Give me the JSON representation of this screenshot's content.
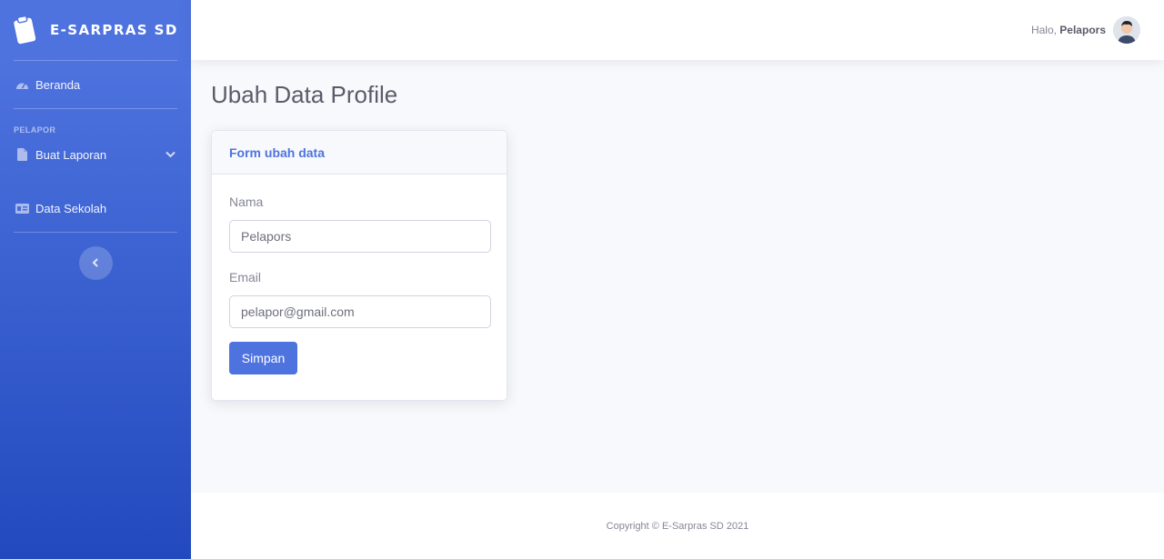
{
  "sidebar": {
    "brand": "E-SARPRAS SD",
    "items": [
      {
        "label": "Beranda",
        "icon": "dashboard-icon"
      },
      {
        "label": "Buat Laporan",
        "icon": "file-icon"
      },
      {
        "label": "Data Sekolah",
        "icon": "id-card-icon"
      }
    ],
    "heading": "PELAPOR",
    "accent": "#4e73df"
  },
  "topbar": {
    "greeting": "Halo,",
    "user_name": "Pelapors"
  },
  "main": {
    "title": "Ubah Data Profile",
    "card": {
      "header": "Form ubah data",
      "fields": [
        {
          "label": "Nama",
          "value": "Pelapors"
        },
        {
          "label": "Email",
          "value": "pelapor@gmail.com"
        }
      ],
      "submit": "Simpan"
    }
  },
  "footer": {
    "text": "Copyright © E-Sarpras SD 2021"
  }
}
